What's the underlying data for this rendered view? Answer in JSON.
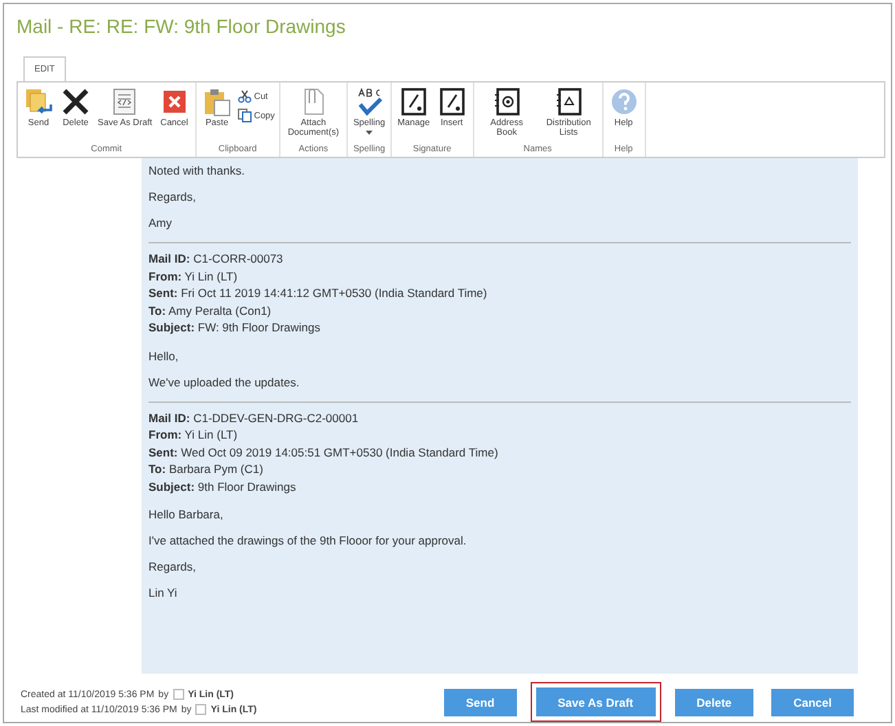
{
  "window": {
    "title": "Mail - RE: RE: FW: 9th Floor Drawings"
  },
  "tabs": [
    {
      "label": "EDIT",
      "selected": true
    }
  ],
  "ribbon": {
    "groups": [
      {
        "label": "Commit",
        "items": [
          {
            "label": "Send",
            "kind": "large"
          },
          {
            "label": "Delete",
            "kind": "large"
          },
          {
            "label": "Save As Draft",
            "kind": "large"
          },
          {
            "label": "Cancel",
            "kind": "large"
          }
        ]
      },
      {
        "label": "Clipboard",
        "items": [
          {
            "label": "Paste",
            "kind": "large"
          },
          {
            "label": "Cut",
            "kind": "small"
          },
          {
            "label": "Copy",
            "kind": "small"
          }
        ]
      },
      {
        "label": "Actions",
        "items": [
          {
            "label": "Attach Document(s)",
            "kind": "large"
          }
        ]
      },
      {
        "label": "Spelling",
        "items": [
          {
            "label": "Spelling",
            "kind": "dropdown"
          }
        ]
      },
      {
        "label": "Signature",
        "items": [
          {
            "label": "Manage",
            "kind": "large"
          },
          {
            "label": "Insert",
            "kind": "large"
          }
        ]
      },
      {
        "label": "Names",
        "items": [
          {
            "label": "Address Book",
            "kind": "large"
          },
          {
            "label": "Distribution Lists",
            "kind": "large"
          }
        ]
      },
      {
        "label": "Help",
        "items": [
          {
            "label": "Help",
            "kind": "large"
          }
        ]
      }
    ]
  },
  "body": {
    "paragraphs": [
      "Noted with thanks.",
      "Regards,",
      "Amy"
    ],
    "quoted": [
      {
        "header": [
          {
            "label": "Mail ID:",
            "value": "C1-CORR-00073"
          },
          {
            "label": "From:",
            "value": "Yi Lin (LT)"
          },
          {
            "label": "Sent:",
            "value": "Fri Oct 11 2019 14:41:12 GMT+0530 (India Standard Time)"
          },
          {
            "label": "To:",
            "value": "Amy Peralta (Con1)"
          },
          {
            "label": "Subject:",
            "value": "FW: 9th Floor Drawings"
          }
        ],
        "paragraphs": [
          "Hello,",
          "We've uploaded the updates."
        ]
      },
      {
        "header": [
          {
            "label": "Mail ID:",
            "value": "C1-DDEV-GEN-DRG-C2-00001"
          },
          {
            "label": "From:",
            "value": "Yi Lin (LT)"
          },
          {
            "label": "Sent:",
            "value": "Wed Oct 09 2019 14:05:51 GMT+0530 (India Standard Time)"
          },
          {
            "label": "To:",
            "value": "Barbara Pym (C1)"
          },
          {
            "label": "Subject:",
            "value": "9th Floor Drawings"
          }
        ],
        "paragraphs": [
          "Hello Barbara,",
          "I've attached the drawings of the 9th Flooor for your approval.",
          "Regards,",
          "Lin Yi"
        ]
      }
    ]
  },
  "footer": {
    "lines": [
      {
        "text": "Created at 11/10/2019 5:36 PM",
        "by": "by",
        "user": "Yi Lin (LT)"
      },
      {
        "text": "Last modified at 11/10/2019 5:36 PM",
        "by": "by",
        "user": "Yi Lin (LT)"
      }
    ],
    "buttons": [
      {
        "label": "Send",
        "focused": false
      },
      {
        "label": "Save As Draft",
        "focused": true
      },
      {
        "label": "Delete",
        "focused": false
      },
      {
        "label": "Cancel",
        "focused": false
      }
    ]
  }
}
